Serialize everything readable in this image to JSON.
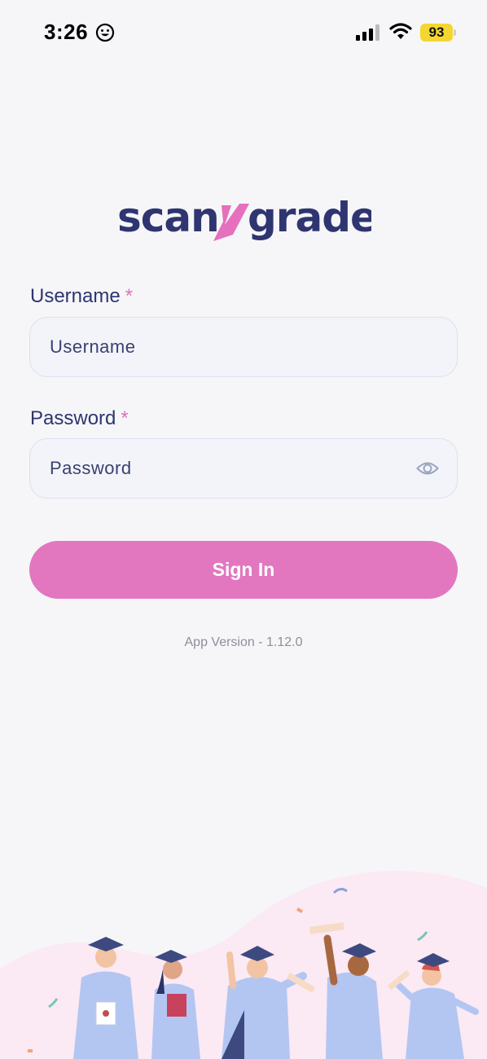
{
  "status_bar": {
    "time": "3:26",
    "battery": "93",
    "icons": [
      "smiley-icon",
      "cellular-signal-icon",
      "wifi-icon",
      "battery-icon"
    ]
  },
  "logo": {
    "part1": "scan",
    "part2": "grade"
  },
  "form": {
    "username_label": "Username",
    "username_required": "*",
    "username_placeholder": "Username",
    "password_label": "Password",
    "password_required": "*",
    "password_placeholder": "Password",
    "sign_in_label": "Sign In"
  },
  "footer": {
    "version": "App Version - 1.12.0"
  },
  "colors": {
    "brand_navy": "#2e3570",
    "brand_pink": "#e277bf",
    "background": "#f6f6f8"
  }
}
